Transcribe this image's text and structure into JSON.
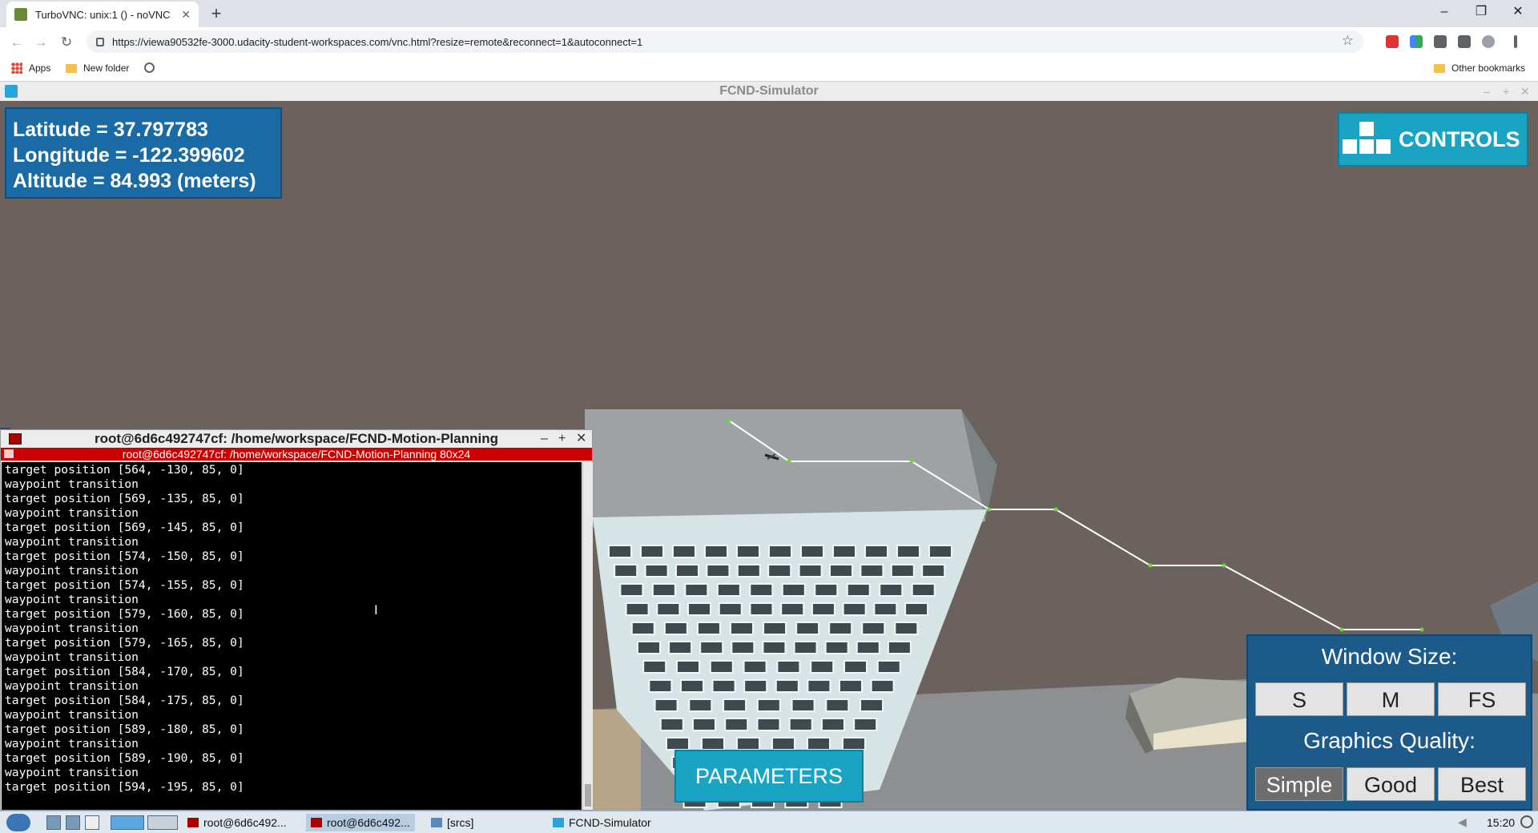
{
  "browser": {
    "tab_title": "TurboVNC: unix:1 () - noVNC",
    "url": "https://viewa90532fe-3000.udacity-student-workspaces.com/vnc.html?resize=remote&reconnect=1&autoconnect=1",
    "bookmarks": [
      "Apps",
      "New folder",
      "Other bookmarks"
    ]
  },
  "vnc_window": {
    "title": "FCND-Simulator"
  },
  "hud": {
    "latitude": "Latitude = 37.797783",
    "longitude": "Longitude = -122.399602",
    "altitude": "Altitude = 84.993 (meters)"
  },
  "controls_label": "CONTROLS",
  "parameters_label": "PARAMETERS",
  "settings": {
    "window_size_label": "Window Size:",
    "window_sizes": [
      "S",
      "M",
      "FS"
    ],
    "graphics_label": "Graphics Quality:",
    "graphics_options": [
      "Simple",
      "Good",
      "Best"
    ],
    "graphics_selected": "Simple"
  },
  "terminal": {
    "title": "root@6d6c492747cf: /home/workspace/FCND-Motion-Planning",
    "subtitle": "root@6d6c492747cf: /home/workspace/FCND-Motion-Planning 80x24",
    "lines": [
      "target position [564, -130, 85, 0]",
      "waypoint transition",
      "target position [569, -135, 85, 0]",
      "waypoint transition",
      "target position [569, -145, 85, 0]",
      "waypoint transition",
      "target position [574, -150, 85, 0]",
      "waypoint transition",
      "target position [574, -155, 85, 0]",
      "waypoint transition",
      "target position [579, -160, 85, 0]",
      "waypoint transition",
      "target position [579, -165, 85, 0]",
      "waypoint transition",
      "target position [584, -170, 85, 0]",
      "waypoint transition",
      "target position [584, -175, 85, 0]",
      "waypoint transition",
      "target position [589, -180, 85, 0]",
      "waypoint transition",
      "target position [589, -190, 85, 0]",
      "waypoint transition",
      "target position [594, -195, 85, 0]"
    ]
  },
  "taskbar": {
    "items": [
      "root@6d6c492...",
      "root@6d6c492...",
      "[srcs]",
      "FCND-Simulator"
    ],
    "clock": "15:20"
  },
  "colors": {
    "hud_panel": "#1a6aa6",
    "button_cyan": "#1aa4c4",
    "path_line": "#ffffff",
    "waypoint_dot": "#66dd33",
    "terminal_titlebar": "#cc0000"
  }
}
